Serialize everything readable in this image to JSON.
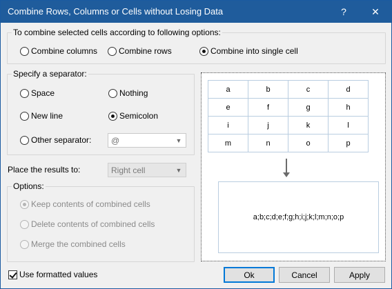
{
  "window": {
    "title": "Combine Rows, Columns or Cells without Losing Data",
    "help_glyph": "?",
    "close_glyph": "✕"
  },
  "combine_options": {
    "legend": "To combine selected cells according to following options:",
    "items": [
      {
        "label": "Combine columns",
        "checked": false
      },
      {
        "label": "Combine rows",
        "checked": false
      },
      {
        "label": "Combine into single cell",
        "checked": true
      }
    ]
  },
  "separator": {
    "legend": "Specify a separator:",
    "items": [
      {
        "label": "Space",
        "checked": false
      },
      {
        "label": "Nothing",
        "checked": false
      },
      {
        "label": "New line",
        "checked": false
      },
      {
        "label": "Semicolon",
        "checked": true
      },
      {
        "label": "Other separator:",
        "checked": false
      }
    ],
    "other_value": "@"
  },
  "place_results": {
    "label": "Place the results to:",
    "value": "Right cell"
  },
  "options": {
    "legend": "Options:",
    "items": [
      {
        "label": "Keep contents of combined cells",
        "checked": true
      },
      {
        "label": "Delete contents of combined cells",
        "checked": false
      },
      {
        "label": "Merge the combined cells",
        "checked": false
      }
    ]
  },
  "preview": {
    "grid": [
      [
        "a",
        "b",
        "c",
        "d"
      ],
      [
        "e",
        "f",
        "g",
        "h"
      ],
      [
        "i",
        "j",
        "k",
        "l"
      ],
      [
        "m",
        "n",
        "o",
        "p"
      ]
    ],
    "result": "a;b;c;d;e;f;g;h;i;j;k;l;m;n;o;p"
  },
  "footer": {
    "use_formatted_label": "Use formatted values",
    "use_formatted_checked": true,
    "ok_label": "Ok",
    "cancel_label": "Cancel",
    "apply_label": "Apply"
  }
}
